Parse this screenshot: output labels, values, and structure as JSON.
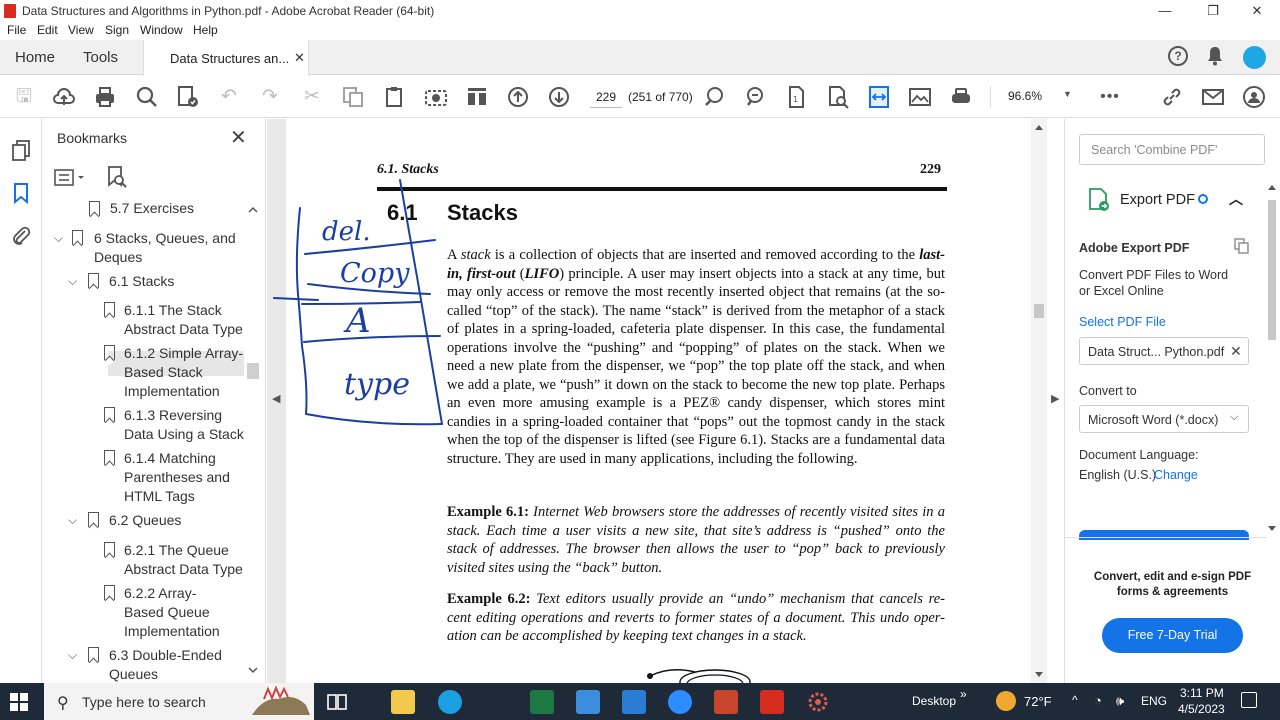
{
  "window": {
    "title": "Data Structures and Algorithms in Python.pdf - Adobe Acrobat Reader (64-bit)",
    "min": "—",
    "max": "❐",
    "close": "✕"
  },
  "menu": [
    "File",
    "Edit",
    "View",
    "Sign",
    "Window",
    "Help"
  ],
  "tabs": {
    "home": "Home",
    "tools": "Tools",
    "doc": "Data Structures an...",
    "doc_close": "✕"
  },
  "toolbar": {
    "page": "229",
    "page_count": "(251 of 770)",
    "zoom": "96.6%",
    "more": "•••"
  },
  "bookmarks": {
    "title": "Bookmarks",
    "close": "✕",
    "items": [
      {
        "label": "5.7 Exercises"
      },
      {
        "label": "6 Stacks, Queues, and Deques"
      },
      {
        "label": "6.1 Stacks"
      },
      {
        "label": "6.1.1 The Stack Abstract Data Type"
      },
      {
        "label": "6.1.2 Simple Array-Based Stack Implementation"
      },
      {
        "label": "6.1.3 Reversing Data Using a Stack"
      },
      {
        "label": "6.1.4 Matching Parentheses and HTML Tags"
      },
      {
        "label": "6.2 Queues"
      },
      {
        "label": "6.2.1 The Queue Abstract Data Type"
      },
      {
        "label": "6.2.2 Array-Based Queue Implementation"
      },
      {
        "label": "6.3 Double-Ended Queues"
      }
    ]
  },
  "document": {
    "running_head": "6.1. Stacks",
    "page_number": "229",
    "section_number": "6.1",
    "section_title": "Stacks",
    "para_a": "A ",
    "para_stack": "stack",
    "para_b": " is a collection of objects that are inserted and removed according to the ",
    "para_lifo1": "last-in, first-out",
    "para_c": " (",
    "para_lifo2": "LIFO",
    "para_d": ") principle.  A user may insert objects into a stack at any time, but may only access or remove the most recently inserted object that remains (at the so-called “top” of the stack). The name “stack” is derived from the metaphor of a stack of plates in a spring-loaded, cafeteria plate dispenser.  In this case, the fundamental operations involve the “pushing” and “popping” of plates on the stack. When we need a new plate from the dispenser, we “pop” the top plate off the stack, and when we add a plate, we “push” it down on the stack to become the new top plate. Perhaps an even more amusing example is a PEZ® candy dispenser, which stores mint candies in a spring-loaded container that “pops” out the topmost candy in the stack when the top of the dispenser is lifted (see Figure 6.1).  Stacks are a fundamental data structure.  They are used in many applications, including the following.",
    "ex1_label": "Example 6.1:",
    "ex1_text": " Internet Web browsers store the addresses of recently visited sites in a stack. Each time a user visits a new site, that site’s address is “pushed” onto the stack of addresses.  The browser then allows the user to “pop” back to previously visited sites using the “back” button.",
    "ex2_label": "Example 6.2:",
    "ex2_text": " Text editors usually provide an “undo” mechanism that cancels re-cent editing operations and reverts to former states of a document.  This undo oper-ation can be accomplished by keeping text changes in a stack.",
    "handwriting": {
      "w1": "del.",
      "w2": "Copy",
      "w3": "A",
      "w4": "type"
    }
  },
  "right_pane": {
    "search_placeholder": "Search 'Combine PDF'",
    "export_title": "Export PDF",
    "section_title": "Adobe Export PDF",
    "desc": "Convert PDF Files to Word or Excel Online",
    "select_label": "Select PDF File",
    "file_name": "Data Struct... Python.pdf",
    "convert_label": "Convert to",
    "convert_value": "Microsoft Word (*.docx)",
    "lang_label": "Document Language:",
    "lang_value": "English (U.S.)",
    "lang_change": "Change",
    "promo": "Convert, edit and e-sign PDF forms & agreements",
    "trial": "Free 7-Day Trial"
  },
  "taskbar": {
    "search_placeholder": "Type here to search",
    "desktop": "Desktop",
    "weather": "72°F",
    "lang": "ENG",
    "time": "3:11 PM",
    "date": "4/5/2023",
    "chevron": "»"
  },
  "colors": {
    "accent": "#1473e6",
    "ink": "#1a3fa0",
    "taskbar": "#1e2a38"
  }
}
